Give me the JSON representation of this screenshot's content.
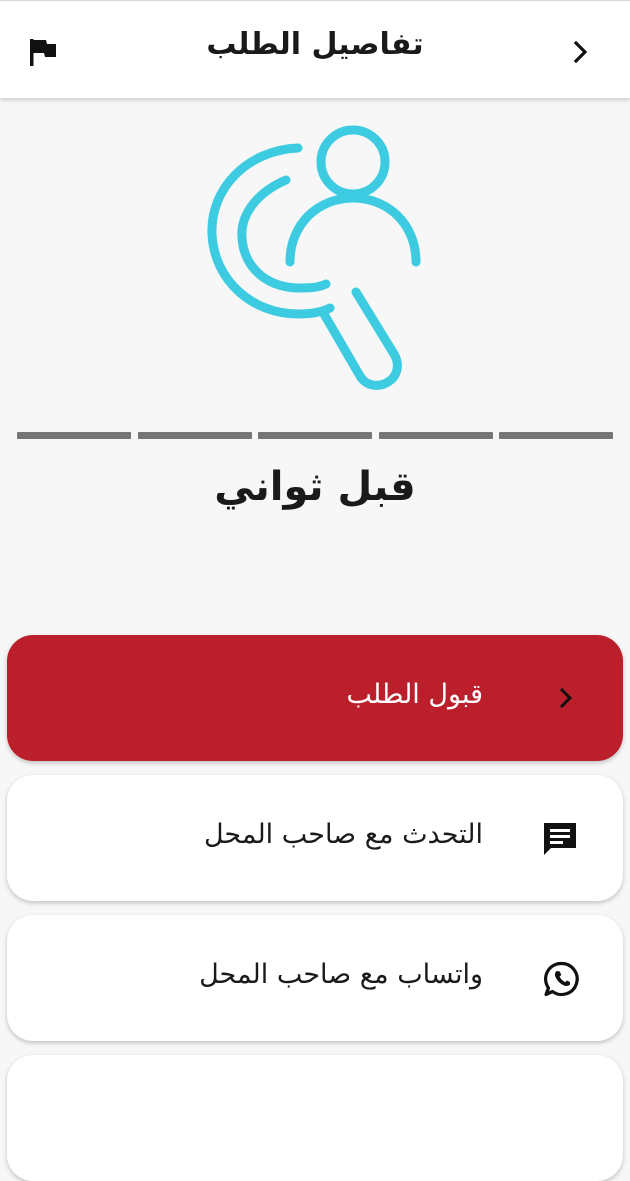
{
  "header": {
    "title": "تفاصيل الطلب",
    "back_icon": "chevron-right-icon",
    "report_icon": "flag-icon"
  },
  "hero": {
    "icon": "search-user-icon",
    "color": "#3ccbe0"
  },
  "progress": {
    "segments": 5,
    "color": "#757575"
  },
  "status": {
    "time_ago": "قبل ثواني"
  },
  "actions": [
    {
      "label": "قبول الطلب",
      "icon": "chevron-right-icon",
      "color": "#bc1f2c"
    },
    {
      "label": "التحدث مع صاحب المحل",
      "icon": "chat-icon"
    },
    {
      "label": "واتساب مع صاحب المحل",
      "icon": "whatsapp-icon"
    }
  ]
}
